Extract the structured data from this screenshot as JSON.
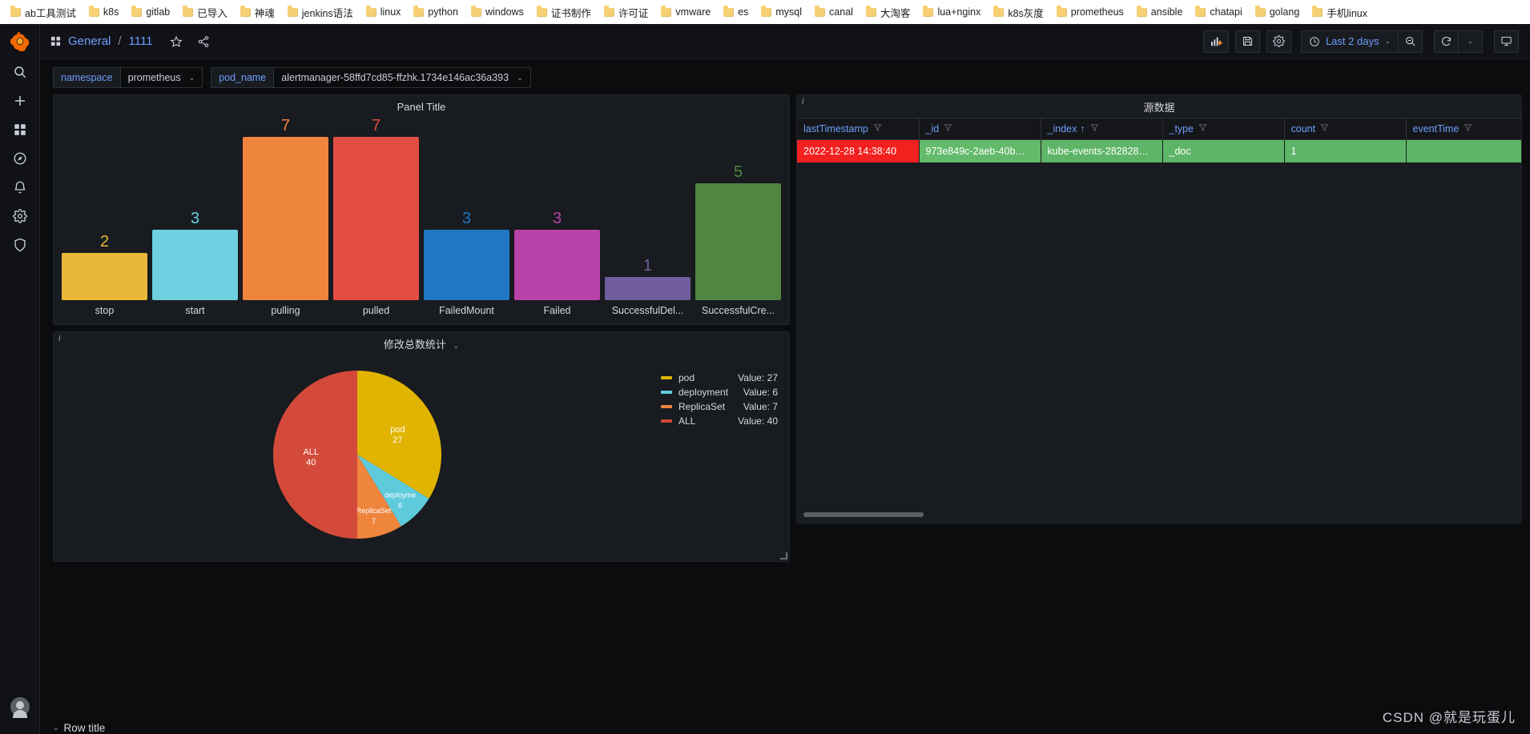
{
  "browser": {
    "bookmarks": [
      "ab工具测试",
      "k8s",
      "gitlab",
      "已导入",
      "神魂",
      "jenkins语法",
      "linux",
      "python",
      "windows",
      "证书制作",
      "许可证",
      "vmware",
      "es",
      "mysql",
      "canal",
      "大淘客",
      "lua+nginx",
      "k8s灰度",
      "prometheus",
      "ansible",
      "chatapi",
      "golang",
      "手机linux"
    ]
  },
  "side_rail": {
    "items": [
      {
        "name": "search-icon",
        "label": "Search"
      },
      {
        "name": "plus-icon",
        "label": "Create"
      },
      {
        "name": "dashboards-icon",
        "label": "Dashboards"
      },
      {
        "name": "explore-icon",
        "label": "Explore"
      },
      {
        "name": "bell-icon",
        "label": "Alerting"
      },
      {
        "name": "gear-icon",
        "label": "Configuration"
      },
      {
        "name": "shield-icon",
        "label": "Server Admin"
      }
    ]
  },
  "nav": {
    "breadcrumb_folder": "General",
    "breadcrumb_separator": "/",
    "breadcrumb_title": "1111",
    "star_label": "Mark as favorite",
    "share_label": "Share dashboard",
    "add_panel_label": "Add panel",
    "save_label": "Save dashboard",
    "settings_label": "Dashboard settings",
    "time_range": "Last 2 days",
    "zoom_out_label": "Zoom out time range",
    "refresh_label": "Refresh dashboard",
    "refresh_interval_label": "Auto refresh",
    "tv_label": "Cycle view mode"
  },
  "variables": [
    {
      "label": "namespace",
      "value": "prometheus"
    },
    {
      "label": "pod_name",
      "value": "alertmanager-58ffd7cd85-ffzhk.1734e146ac36a393"
    }
  ],
  "panels": {
    "barchart": {
      "title": "Panel Title"
    },
    "pie": {
      "title": "修改总数统计",
      "info": "i"
    },
    "table": {
      "title": "源数据",
      "info": "i"
    }
  },
  "chart_data": [
    {
      "type": "bar",
      "title": "Panel Title",
      "xlabel": "",
      "ylabel": "",
      "ylim": [
        0,
        7
      ],
      "grid": false,
      "legend": "none",
      "categories": [
        "stop",
        "start",
        "pulling",
        "pulled",
        "FailedMount",
        "Failed",
        "SuccessfulDel...",
        "SuccessfulCre..."
      ],
      "values": [
        2,
        3,
        7,
        7,
        3,
        3,
        1,
        5
      ],
      "colors": [
        "#eab839",
        "#6ed0e0",
        "#ef843c",
        "#e24d42",
        "#1f78c1",
        "#ba43a9",
        "#705da0",
        "#508642"
      ]
    },
    {
      "type": "pie",
      "title": "修改总数统计",
      "legend_position": "right",
      "labels": [
        "pod",
        "deployment",
        "ReplicaSet",
        "ALL"
      ],
      "values": [
        27,
        6,
        7,
        40
      ],
      "colors": [
        "#e0b400",
        "#5ecbdd",
        "#ef843c",
        "#d44a3a"
      ],
      "legend_value_prefix": "Value: ",
      "slice_labels": [
        {
          "name": "pod",
          "value": "27"
        },
        {
          "name": "deployme",
          "value": "6"
        },
        {
          "name": "ReplicaSet",
          "value": "7"
        },
        {
          "name": "ALL",
          "value": "40"
        }
      ]
    }
  ],
  "table": {
    "columns": [
      {
        "name": "lastTimestamp",
        "sorted": false
      },
      {
        "name": "_id",
        "sorted": false
      },
      {
        "name": "_index",
        "sorted": true,
        "sort_dir": "↑"
      },
      {
        "name": "_type",
        "sorted": false
      },
      {
        "name": "count",
        "sorted": false
      },
      {
        "name": "eventTime",
        "sorted": false
      }
    ],
    "rows": [
      {
        "cells": [
          {
            "text": "2022-12-28 14:38:40",
            "bg": "#f2201f"
          },
          {
            "text": "973e849c-2aeb-40b…",
            "bg": "#63ba6b"
          },
          {
            "text": "kube-events-282828…",
            "bg": "#5fb567"
          },
          {
            "text": "_doc",
            "bg": "#5fb567"
          },
          {
            "text": "1",
            "bg": "#5fb567"
          },
          {
            "text": "",
            "bg": "#5fb567"
          }
        ]
      }
    ]
  },
  "row": {
    "title": "Row title"
  },
  "watermark": "CSDN @就是玩蛋儿"
}
